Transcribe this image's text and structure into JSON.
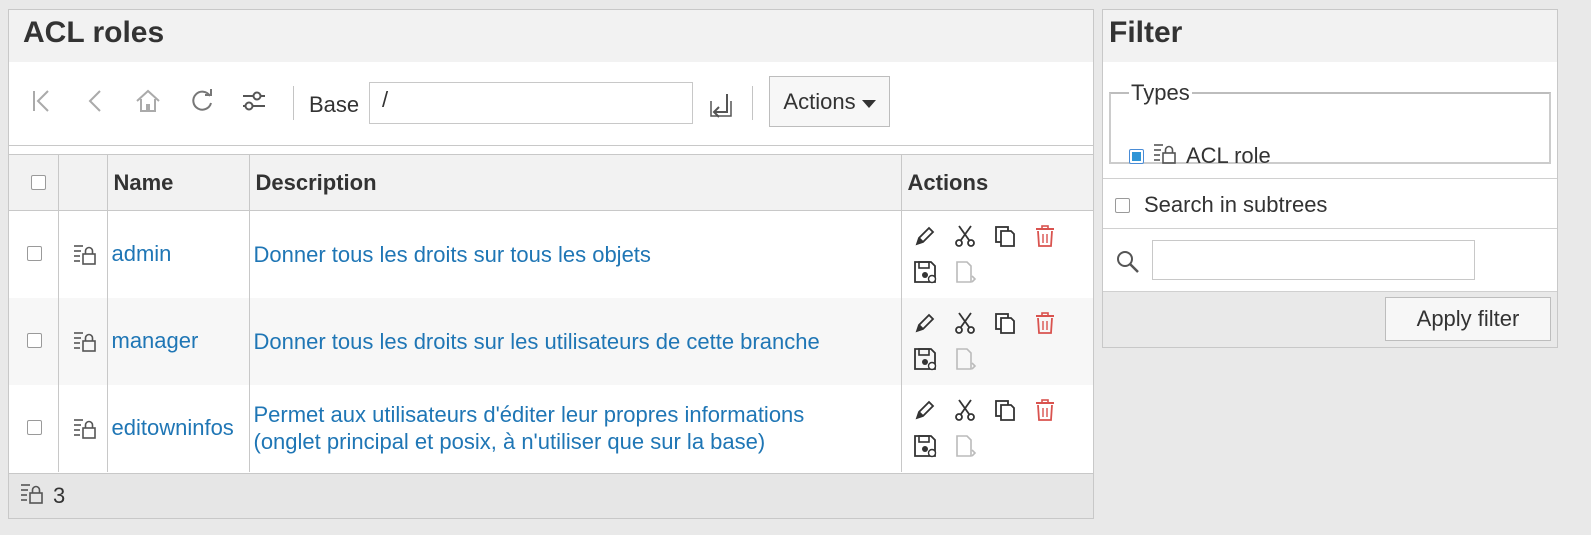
{
  "main": {
    "title": "ACL roles",
    "toolbar": {
      "icons": [
        "first-page-icon",
        "previous-icon",
        "home-icon",
        "refresh-icon",
        "settings-sliders-icon",
        "submit-base-icon"
      ],
      "base_label": "Base",
      "base_value": "/",
      "actions_label": "Actions"
    },
    "table": {
      "columns": [
        "",
        "",
        "Name",
        "Description",
        "Actions"
      ],
      "rows": [
        {
          "name": "admin",
          "description_line1": "Donner tous les droits sur tous les objets",
          "description_line2": ""
        },
        {
          "name": "manager",
          "description_line1": "Donner tous les droits sur les utilisateurs de cette branche",
          "description_line2": ""
        },
        {
          "name": "editowninfos",
          "description_line1": "Permet aux utilisateurs d'éditer leur propres informations",
          "description_line2": "(onglet principal et posix, à n'utiliser que sur la base)"
        }
      ],
      "row_actions": [
        "edit-icon",
        "cut-icon",
        "copy-icon",
        "delete-icon",
        "save-icon",
        "paste-icon"
      ]
    },
    "footer": {
      "count": "3"
    }
  },
  "filter": {
    "title": "Filter",
    "types_legend": "Types",
    "type_option": {
      "label": "ACL role",
      "checked": true
    },
    "subtrees_label": "Search in subtrees",
    "search_placeholder": "",
    "apply_label": "Apply filter"
  },
  "colors": {
    "link": "#1f76b5",
    "delete": "#d9534f",
    "panel_bg": "#f2f2f2"
  }
}
